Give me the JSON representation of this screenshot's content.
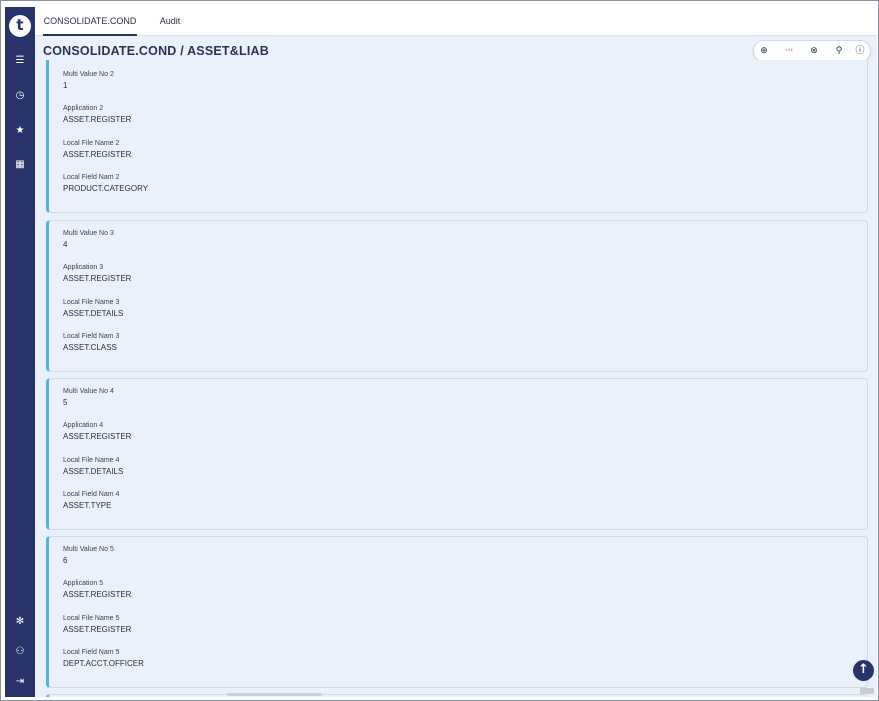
{
  "tabs": [
    {
      "label": "CONSOLIDATE.COND",
      "active": true
    },
    {
      "label": "Audit",
      "active": false
    }
  ],
  "page_title": "CONSOLIDATE.COND / ASSET&LIAB",
  "logo_letter": "t",
  "icons": {
    "menu": "☰",
    "history": "◷",
    "favorites": "★",
    "apps": "▦",
    "settings": "✻",
    "users": "⚇",
    "logout": "⇥",
    "add": "⊕",
    "more": "···",
    "cancel": "⊗",
    "search": "⚲",
    "info": "ⓘ",
    "scroll_up": "↑"
  },
  "cards": [
    {
      "fields": [
        {
          "label": "Multi Value No 2",
          "value": "1"
        },
        {
          "label": "Application 2",
          "value": "ASSET.REGISTER"
        },
        {
          "label": "Local File Name 2",
          "value": "ASSET.REGISTER"
        },
        {
          "label": "Local Field Nam 2",
          "value": "PRODUCT.CATEGORY"
        }
      ]
    },
    {
      "fields": [
        {
          "label": "Multi Value No 3",
          "value": "4"
        },
        {
          "label": "Application 3",
          "value": "ASSET.REGISTER"
        },
        {
          "label": "Local File Name 3",
          "value": "ASSET.DETAILS"
        },
        {
          "label": "Local Field Nam 3",
          "value": "ASSET.CLASS"
        }
      ]
    },
    {
      "fields": [
        {
          "label": "Multi Value No 4",
          "value": "5"
        },
        {
          "label": "Application 4",
          "value": "ASSET.REGISTER"
        },
        {
          "label": "Local File Name 4",
          "value": "ASSET.DETAILS"
        },
        {
          "label": "Local Field Nam 4",
          "value": "ASSET.TYPE"
        }
      ]
    },
    {
      "fields": [
        {
          "label": "Multi Value No 5",
          "value": "6"
        },
        {
          "label": "Application 5",
          "value": "ASSET.REGISTER"
        },
        {
          "label": "Local File Name 5",
          "value": "ASSET.REGISTER"
        },
        {
          "label": "Local Field Nam 5",
          "value": "DEPT.ACCT.OFFICER"
        }
      ]
    }
  ]
}
